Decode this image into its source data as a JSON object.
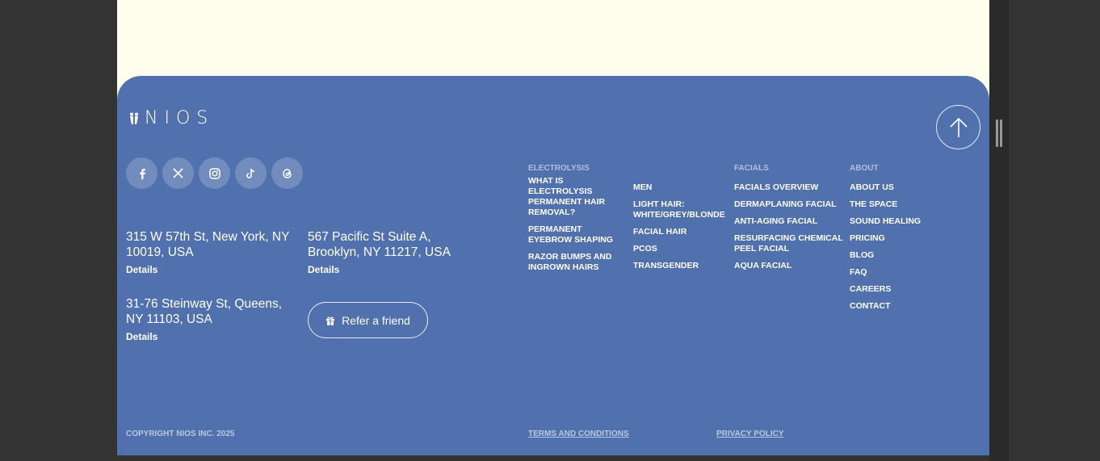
{
  "brand": {
    "logo_text": "NIOS"
  },
  "scroll_top": {
    "icon": "arrow-up-icon"
  },
  "socials": [
    {
      "icon": "facebook-icon",
      "glyph": "f"
    },
    {
      "icon": "x-icon",
      "glyph": "𝕏"
    },
    {
      "icon": "instagram-icon",
      "glyph": "◎"
    },
    {
      "icon": "tiktok-icon",
      "glyph": "♪"
    },
    {
      "icon": "threads-icon",
      "glyph": "@"
    }
  ],
  "locations": [
    {
      "address": "315 W 57th St, New York, NY 10019, USA",
      "link": "Details"
    },
    {
      "address": "567 Pacific St Suite A, Brooklyn, NY 11217, USA",
      "link": "Details"
    },
    {
      "address": "31-76 Steinway St, Queens, NY 11103, USA",
      "link": "Details"
    }
  ],
  "refer": {
    "label": "Refer a friend",
    "icon": "gift-icon"
  },
  "columns": {
    "electrolysis": {
      "heading": "ELECTROLYSIS",
      "items": [
        "WHAT IS ELECTROLYSIS PERMANENT HAIR REMOVAL?",
        "PERMANENT EYEBROW SHAPING",
        "RAZOR BUMPS AND INGROWN HAIRS"
      ]
    },
    "electrolysis_more": {
      "heading": "",
      "items": [
        "MEN",
        "LIGHT HAIR: WHITE/GREY/BLONDE",
        "FACIAL HAIR",
        "PCOS",
        "TRANSGENDER"
      ]
    },
    "facials": {
      "heading": "FACIALS",
      "items": [
        "FACIALS OVERVIEW",
        "DERMAPLANING FACIAL",
        "ANTI-AGING FACIAL",
        "RESURFACING CHEMICAL PEEL FACIAL",
        "AQUA FACIAL"
      ]
    },
    "about": {
      "heading": "ABOUT",
      "items": [
        "ABOUT US",
        "THE SPACE",
        "SOUND HEALING",
        "PRICING",
        "BLOG",
        "FAQ",
        "CAREERS",
        "CONTACT"
      ]
    }
  },
  "legal": {
    "copyright": "COPYRIGHT NIOS INC. 2025",
    "terms": "TERMS AND CONDITIONS",
    "privacy": "PRIVACY POLICY"
  },
  "colors": {
    "footer_bg": "#5070ae",
    "page_bg": "#fffdec",
    "outer_bg": "#333333"
  }
}
